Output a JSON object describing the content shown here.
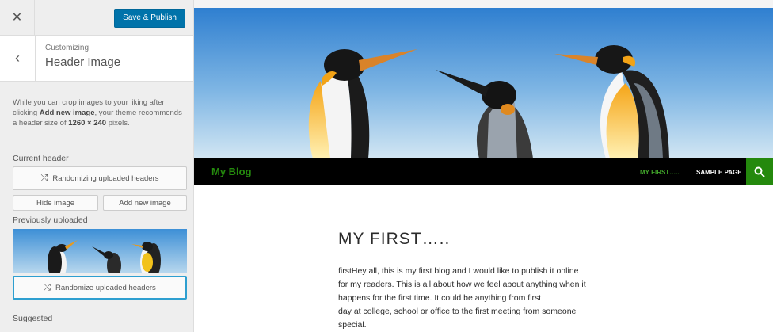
{
  "sidebar": {
    "close_icon": "close-icon",
    "save_label": "Save & Publish",
    "section_subtitle": "Customizing",
    "section_title": "Header Image",
    "description": {
      "part1": "While you can crop images to your liking after clicking ",
      "bold1": "Add new image",
      "part2": ", your theme recommends a header size of ",
      "bold2": "1260 × 240",
      "part3": " pixels."
    },
    "current_header_label": "Current header",
    "randomizing_label": "Randomizing uploaded headers",
    "hide_image_label": "Hide image",
    "add_new_image_label": "Add new image",
    "previously_uploaded_label": "Previously uploaded",
    "randomize_label": "Randomize uploaded headers",
    "suggested_label": "Suggested"
  },
  "preview": {
    "site_title": "My Blog",
    "nav": [
      "MY FIRST…..",
      "SAMPLE PAGE"
    ],
    "post_title": "MY FIRST…..",
    "post_lines": [
      "firstHey all, this is my first blog and I would like to publish it online",
      "for my readers. This is all about how we feel about anything when it",
      "happens for the first time. It could be anything from first",
      "day at college, school or office to the first meeting from someone",
      "special."
    ]
  },
  "colors": {
    "accent_blue": "#0073aa",
    "site_green": "#24890d",
    "nav_active_green": "#41a62a"
  }
}
